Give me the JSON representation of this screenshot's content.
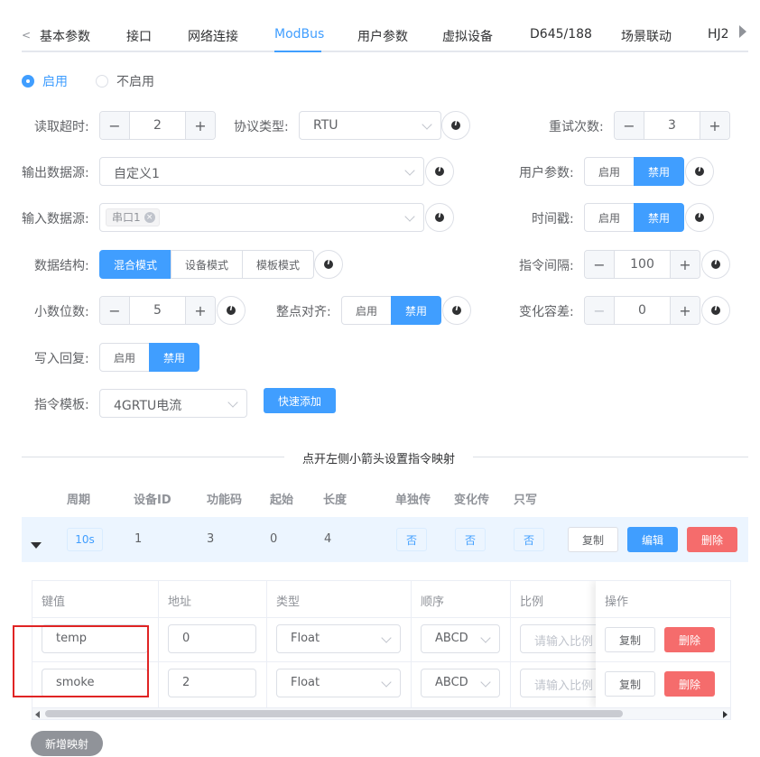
{
  "tabs": {
    "items": [
      "基本参数",
      "接口",
      "网络连接",
      "ModBus",
      "用户参数",
      "虚拟设备",
      "D645/188",
      "场景联动",
      "HJ2"
    ],
    "active_index": 3
  },
  "enable": {
    "on_label": "启用",
    "off_label": "不启用",
    "selected": "启用"
  },
  "form": {
    "read_timeout": {
      "label": "读取超时:",
      "value": "2"
    },
    "protocol_type": {
      "label": "协议类型:",
      "value": "RTU"
    },
    "retry_count": {
      "label": "重试次数:",
      "value": "3"
    },
    "output_source": {
      "label": "输出数据源:",
      "value": "自定义1"
    },
    "user_params": {
      "label": "用户参数:",
      "on": "启用",
      "off": "禁用",
      "selected": "禁用"
    },
    "input_source": {
      "label": "输入数据源:",
      "tag": "串口1"
    },
    "timestamp": {
      "label": "时间戳:",
      "on": "启用",
      "off": "禁用",
      "selected": "禁用"
    },
    "data_struct": {
      "label": "数据结构:",
      "options": [
        "混合模式",
        "设备模式",
        "模板模式"
      ],
      "selected": "混合模式"
    },
    "cmd_interval": {
      "label": "指令间隔:",
      "value": "100"
    },
    "decimals": {
      "label": "小数位数:",
      "value": "5"
    },
    "align": {
      "label": "整点对齐:",
      "on": "启用",
      "off": "禁用",
      "selected": "禁用"
    },
    "tolerance": {
      "label": "变化容差:",
      "value": "0"
    },
    "write_reply": {
      "label": "写入回复:",
      "on": "启用",
      "off": "禁用",
      "selected": "禁用"
    },
    "cmd_template": {
      "label": "指令模板:",
      "value": "4GRTU电流"
    },
    "quick_add": "快速添加"
  },
  "divider_text": "点开左侧小箭头设置指令映射",
  "commands": {
    "headers": [
      "周期",
      "设备ID",
      "功能码",
      "起始",
      "长度",
      "单独传",
      "变化传",
      "只写"
    ],
    "row": {
      "period": "10s",
      "device_id": "1",
      "func_code": "3",
      "start": "0",
      "length": "4",
      "single": "否",
      "change": "否",
      "write_only": "否",
      "copy": "复制",
      "edit": "编辑",
      "delete": "删除"
    }
  },
  "mapping": {
    "headers": [
      "键值",
      "地址",
      "类型",
      "顺序",
      "比例",
      "操作"
    ],
    "rows": [
      {
        "key": "temp",
        "addr": "0",
        "type": "Float",
        "order": "ABCD",
        "ratio_ph": "请输入比例",
        "copy": "复制",
        "delete": "删除"
      },
      {
        "key": "smoke",
        "addr": "2",
        "type": "Float",
        "order": "ABCD",
        "ratio_ph": "请输入比例",
        "copy": "复制",
        "delete": "删除"
      }
    ],
    "add_button": "新增映射"
  },
  "colors": {
    "primary": "#409eff",
    "danger": "#f56c6c",
    "annotation": "#e02424"
  }
}
